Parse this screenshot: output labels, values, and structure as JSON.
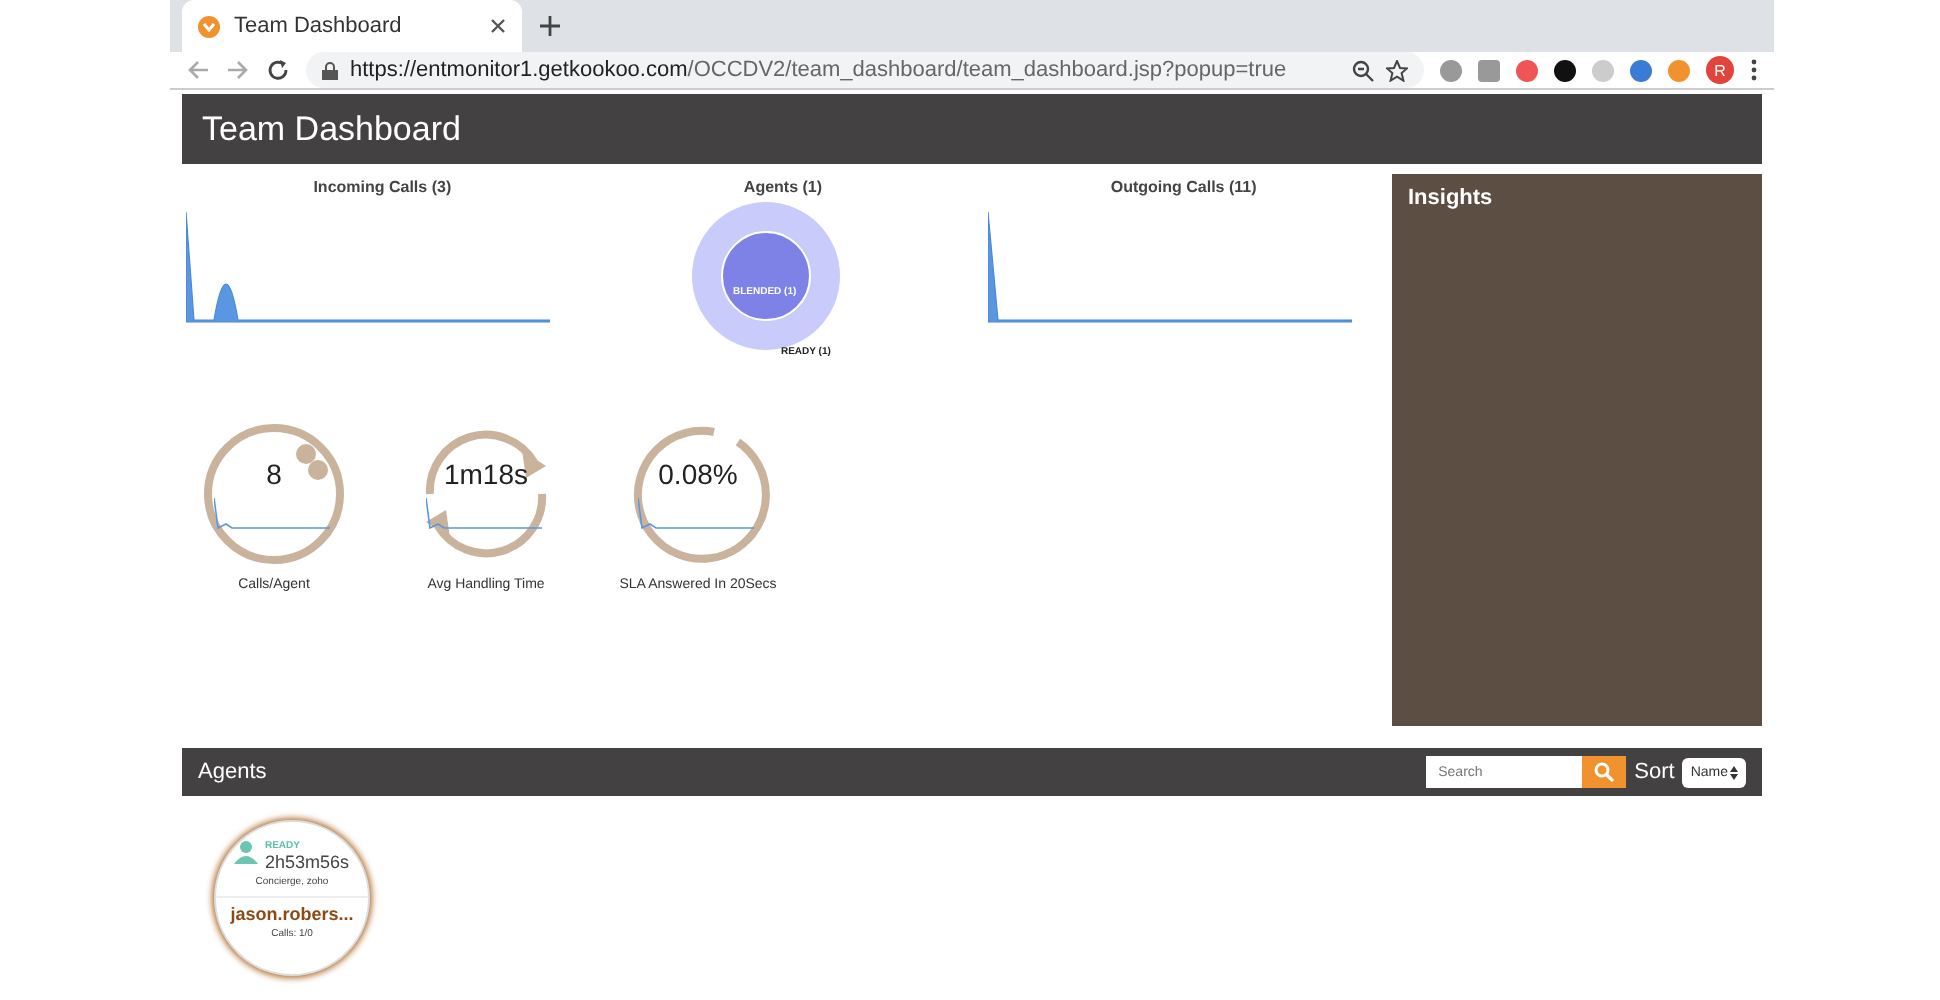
{
  "browser": {
    "tab_title": "Team Dashboard",
    "url_host": "https://entmonitor1.getkookoo.com",
    "url_path": "/OCCDV2/team_dashboard/team_dashboard.jsp?popup=true",
    "profile_initial": "R"
  },
  "header": {
    "title": "Team Dashboard"
  },
  "charts": [
    {
      "kind": "sparkline",
      "title": "Incoming Calls (3)"
    },
    {
      "kind": "donut",
      "title": "Agents (1)",
      "inner_label": "BLENDED (1)",
      "outer_label": "READY (1)"
    },
    {
      "kind": "sparkline",
      "title": "Outgoing Calls (11)"
    }
  ],
  "kpis": [
    {
      "value": "8",
      "label": "Calls/Agent"
    },
    {
      "value": "1m18s",
      "label": "Avg Handling Time"
    },
    {
      "value": "0.08%",
      "label": "SLA Answered In 20Secs"
    }
  ],
  "insights": {
    "title": "Insights"
  },
  "agents_bar": {
    "title": "Agents",
    "search_placeholder": "Search",
    "sort_label": "Sort",
    "sort_value": "Name"
  },
  "agents": [
    {
      "status": "READY",
      "duration": "2h53m56s",
      "groups": "Concierge, zoho",
      "name": "jason.robers...",
      "calls": "Calls: 1/0"
    }
  ]
}
